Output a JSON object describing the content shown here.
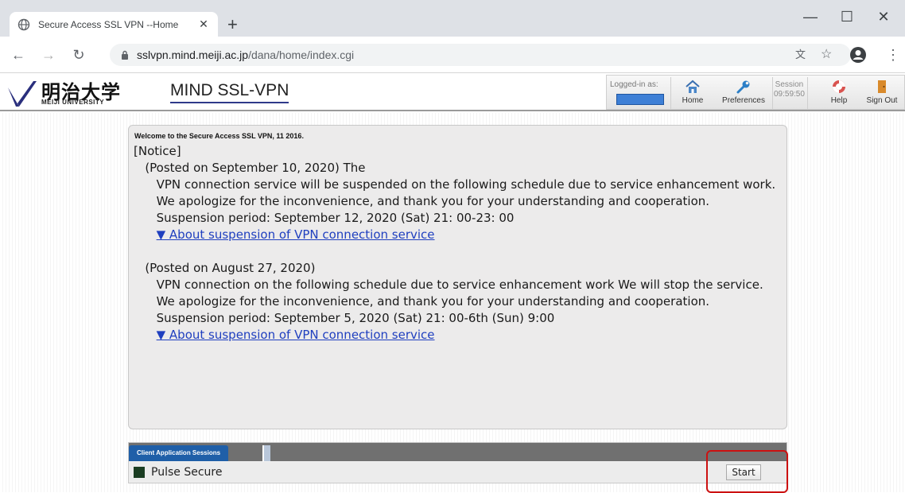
{
  "browser": {
    "tab_title": "Secure Access SSL VPN --Home",
    "tab_close": "✕",
    "new_tab": "+",
    "url_host": "sslvpn.mind.meiji.ac.jp",
    "url_path": "/dana/home/index.cgi",
    "window_controls": [
      "—",
      "☐",
      "✕"
    ]
  },
  "site": {
    "logo_kanji": "明治大学",
    "logo_university": "MEIJI UNIVERSITY",
    "name": "MIND SSL-VPN",
    "logged_in_label": "Logged-in as:",
    "tools": [
      {
        "label": "Home",
        "icon": "home-icon"
      },
      {
        "label": "Preferences",
        "icon": "wrench-icon"
      },
      {
        "label": "Help",
        "icon": "lifebuoy-icon"
      },
      {
        "label": "Sign Out",
        "icon": "door-icon"
      }
    ],
    "session_label": "Session",
    "session_time": "09:59:50"
  },
  "panel": {
    "welcome": "Welcome to the Secure Access SSL VPN, 11 2016.",
    "notice_heading": "[Notice]",
    "notice1_posted": "   (Posted on September 10, 2020) The",
    "notice1_body": "      VPN connection service will be suspended on the following schedule due to service enhancement work.",
    "notice1_apology": "      We apologize for the inconvenience, and thank you for your understanding and cooperation.",
    "notice1_period": "      Suspension period: September 12, 2020 (Sat) 21: 00-23: 00",
    "notice1_link": "▼ About suspension of VPN connection service",
    "notice2_posted": "   (Posted on August 27, 2020)",
    "notice2_body": "      VPN connection on the following schedule due to service enhancement work We will stop the service.",
    "notice2_apology": "      We apologize for the inconvenience, and thank you for your understanding and cooperation.",
    "notice2_period": "      Suspension period: September 5, 2020 (Sat) 21: 00-6th (Sun) 9:00",
    "notice2_link": "▼ About suspension of VPN connection service"
  },
  "client_sessions": {
    "header": "Client Application Sessions",
    "app_name": "Pulse Secure",
    "start_label": "Start"
  },
  "colors": {
    "link": "#1f3fbf",
    "highlight": "#cc1111",
    "tab_blue": "#1f5fa8"
  }
}
